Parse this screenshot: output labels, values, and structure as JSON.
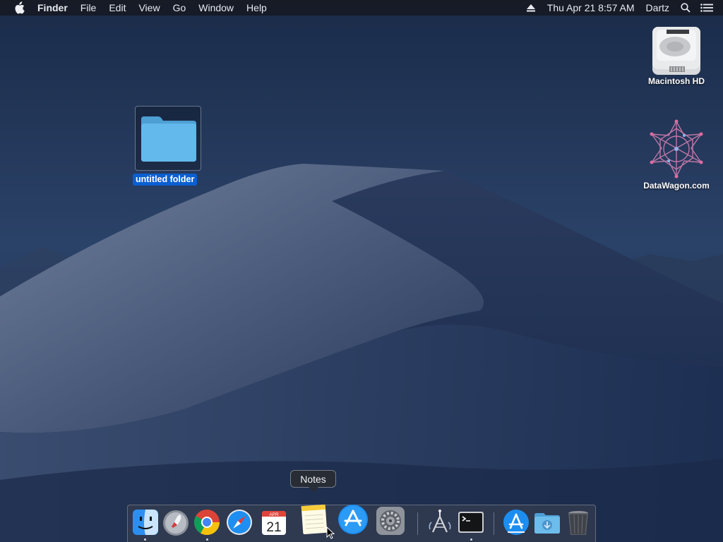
{
  "menubar": {
    "app_name": "Finder",
    "items": [
      "File",
      "Edit",
      "View",
      "Go",
      "Window",
      "Help"
    ],
    "datetime": "Thu Apr 21  8:57 AM",
    "user": "Dartz"
  },
  "desktop": {
    "folder_label": "untitled folder",
    "drive_label": "Macintosh HD",
    "app_label": "DataWagon.com"
  },
  "dock": {
    "tooltip": "Notes",
    "calendar_month": "APR",
    "calendar_day": "21",
    "apps": [
      "finder-icon",
      "launchpad-icon",
      "chrome-icon",
      "safari-icon",
      "calendar-icon",
      "notes-icon",
      "app-store-icon",
      "system-preferences-icon",
      "network-radar-icon",
      "terminal-icon",
      "app-store-downloads-icon",
      "downloads-folder-icon",
      "trash-icon"
    ]
  },
  "colors": {
    "selection": "#0b5fd0",
    "folder": "#5fb6ea",
    "menubar": "#161a24"
  }
}
